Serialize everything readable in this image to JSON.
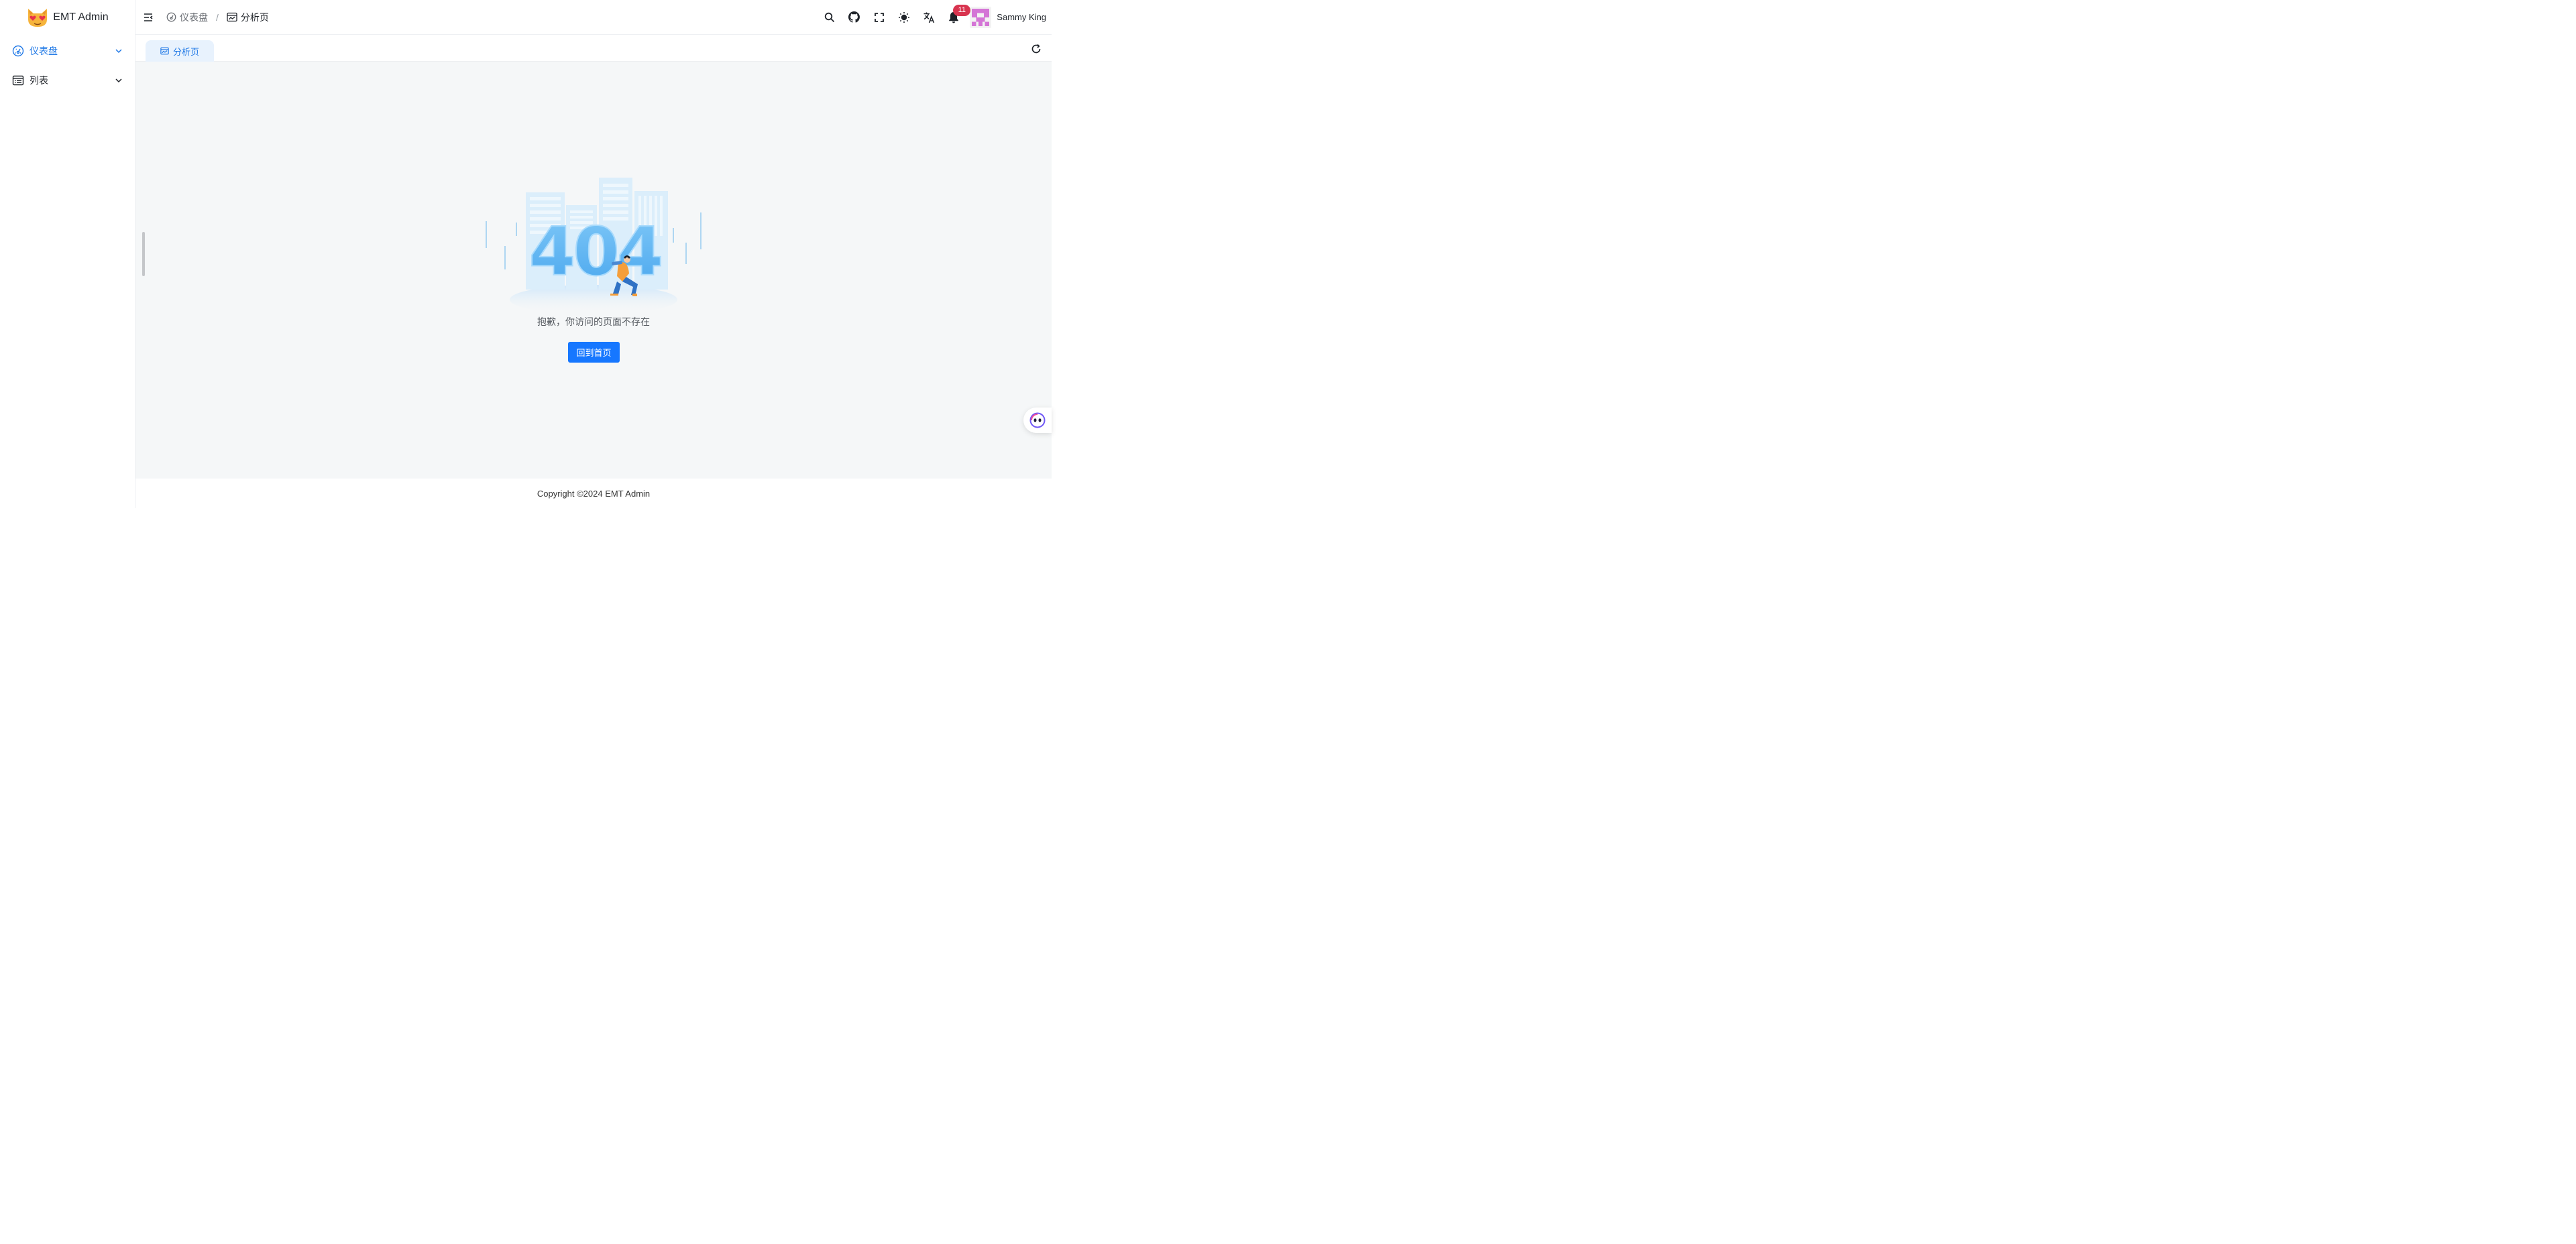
{
  "app": {
    "title": "EMT Admin"
  },
  "sidebar": {
    "items": [
      {
        "label": "仪表盘",
        "icon": "dashboard-icon",
        "active": true
      },
      {
        "label": "列表",
        "icon": "list-icon",
        "active": false
      }
    ]
  },
  "breadcrumb": [
    {
      "label": "仪表盘",
      "icon": "dashboard-icon"
    },
    {
      "label": "分析页",
      "icon": "analysis-icon"
    }
  ],
  "header": {
    "notifications_count": "11",
    "user_name": "Sammy King"
  },
  "tabs": [
    {
      "label": "分析页",
      "icon": "analysis-icon"
    }
  ],
  "main": {
    "error_code": "404",
    "message": "抱歉，你访问的页面不存在",
    "home_button": "回到首页"
  },
  "footer": {
    "copyright": "Copyright ©2024 EMT Admin"
  },
  "colors": {
    "accent": "#1677ff",
    "active_text": "#1f78e6",
    "tab_bg": "#e8f2fd",
    "badge": "#d8344f",
    "content_bg": "#f5f7f8"
  }
}
